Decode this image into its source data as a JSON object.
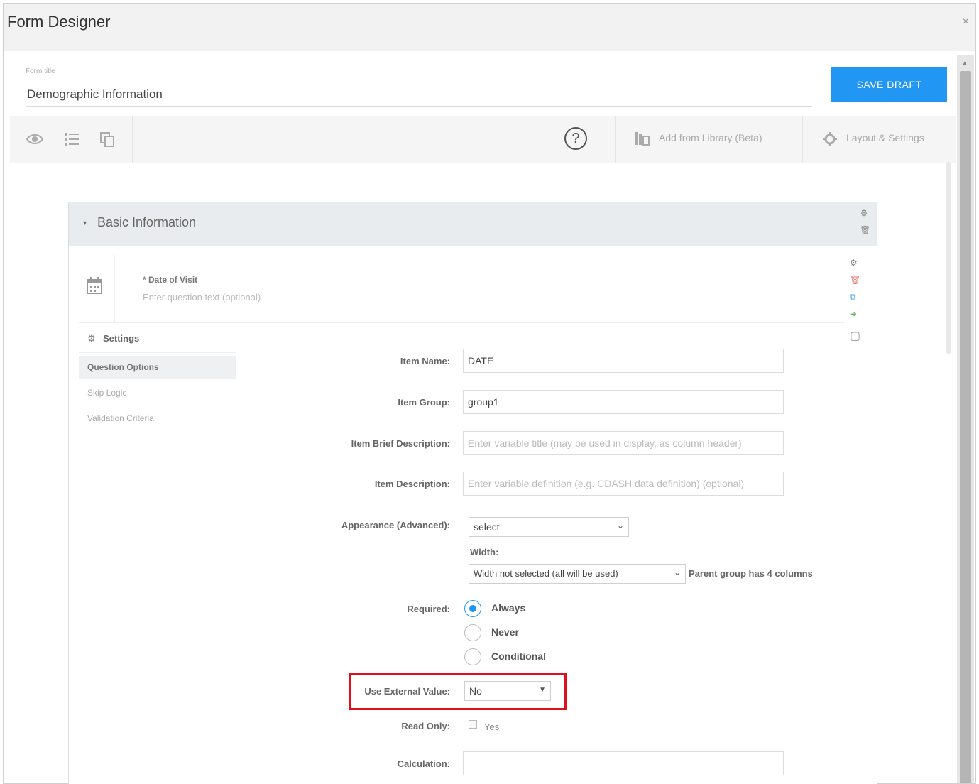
{
  "window": {
    "title": "Form Designer",
    "close_glyph": "×"
  },
  "form": {
    "title_label": "Form title",
    "title_value": "Demographic Information",
    "save_label": "SAVE DRAFT"
  },
  "toolbar": {
    "left_icons": [
      "eye-icon",
      "list-icon",
      "copy-icon"
    ],
    "help_glyph": "?",
    "add_library_label": "Add from Library (Beta)",
    "layout_settings_label": "Layout & Settings"
  },
  "section": {
    "caret": "▾",
    "title": "Basic Information"
  },
  "question": {
    "required_marker": "*",
    "name": "Date of Visit",
    "text_placeholder": "Enter question text (optional)"
  },
  "settings": {
    "header": "Settings",
    "tabs": [
      "Question Options",
      "Skip Logic",
      "Validation Criteria"
    ]
  },
  "fields": {
    "item_name": {
      "label": "Item Name:",
      "value": "DATE"
    },
    "item_group": {
      "label": "Item Group:",
      "value": "group1"
    },
    "item_brief": {
      "label": "Item Brief Description:",
      "placeholder": "Enter variable title (may be used in display, as column header)"
    },
    "item_desc": {
      "label": "Item Description:",
      "placeholder": "Enter variable definition (e.g. CDASH data definition) (optional)"
    },
    "appearance": {
      "label": "Appearance (Advanced):",
      "value": "select"
    },
    "width": {
      "label": "Width:",
      "value": "Width not selected (all will be used)",
      "note": "Parent group has 4 columns"
    },
    "required": {
      "label": "Required:",
      "options": [
        "Always",
        "Never",
        "Conditional"
      ],
      "selected": "Always"
    },
    "external": {
      "label": "Use External Value:",
      "value": "No"
    },
    "read_only": {
      "label": "Read Only:",
      "option": "Yes"
    },
    "calculation": {
      "label": "Calculation:"
    }
  },
  "colors": {
    "accent": "#2196f3",
    "highlight": "#e0101a"
  }
}
